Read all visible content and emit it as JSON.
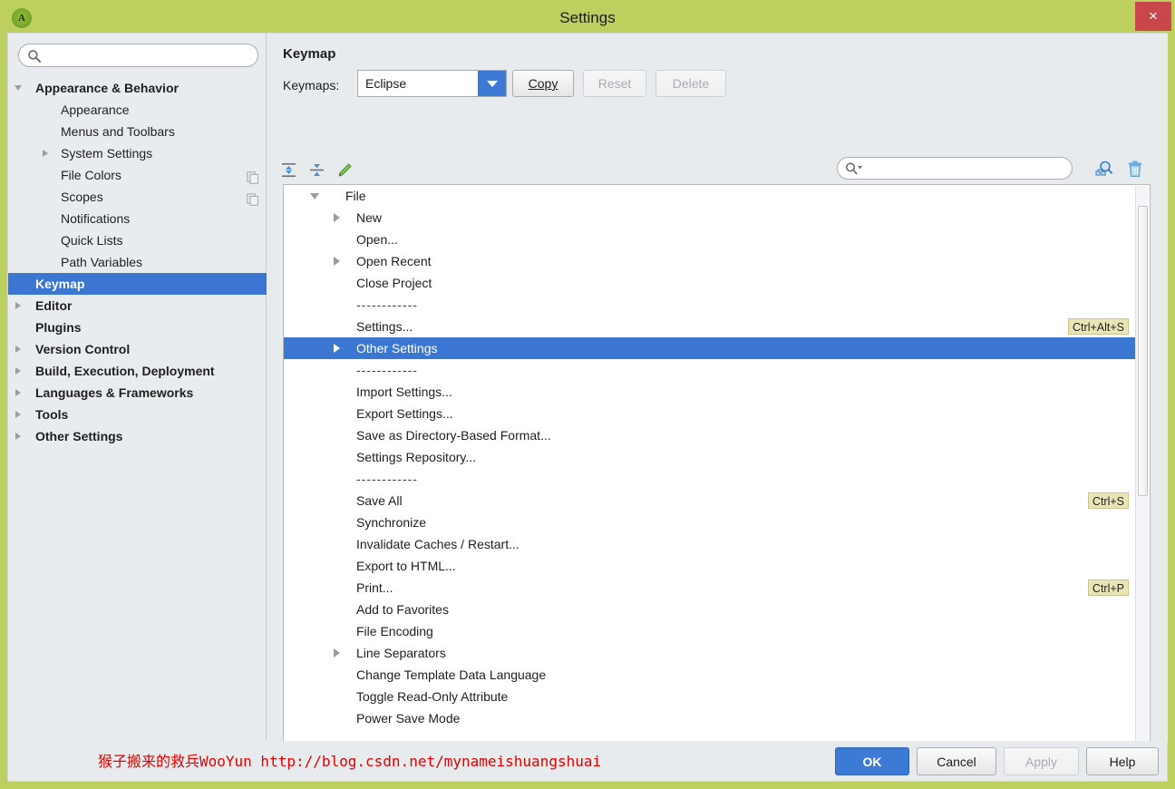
{
  "window": {
    "title": "Settings",
    "app_icon": "android-studio-icon",
    "close_label": "×",
    "titlebar_color": "#bccf5f",
    "accent_color": "#3a76d2"
  },
  "sidebar": {
    "search": {
      "placeholder": "",
      "value": "",
      "icon": "search-icon"
    },
    "items": [
      {
        "label": "Appearance & Behavior",
        "level": 0,
        "arrow": "down",
        "selected": false,
        "copy_icon": false
      },
      {
        "label": "Appearance",
        "level": 1,
        "arrow": "none",
        "selected": false,
        "copy_icon": false
      },
      {
        "label": "Menus and Toolbars",
        "level": 1,
        "arrow": "none",
        "selected": false,
        "copy_icon": false
      },
      {
        "label": "System Settings",
        "level": 1,
        "arrow": "right",
        "selected": false,
        "copy_icon": false
      },
      {
        "label": "File Colors",
        "level": 1,
        "arrow": "none",
        "selected": false,
        "copy_icon": true
      },
      {
        "label": "Scopes",
        "level": 1,
        "arrow": "none",
        "selected": false,
        "copy_icon": true
      },
      {
        "label": "Notifications",
        "level": 1,
        "arrow": "none",
        "selected": false,
        "copy_icon": false
      },
      {
        "label": "Quick Lists",
        "level": 1,
        "arrow": "none",
        "selected": false,
        "copy_icon": false
      },
      {
        "label": "Path Variables",
        "level": 1,
        "arrow": "none",
        "selected": false,
        "copy_icon": false
      },
      {
        "label": "Keymap",
        "level": 0,
        "arrow": "none",
        "selected": true,
        "copy_icon": false
      },
      {
        "label": "Editor",
        "level": 0,
        "arrow": "right",
        "selected": false,
        "copy_icon": false
      },
      {
        "label": "Plugins",
        "level": 0,
        "arrow": "none",
        "selected": false,
        "copy_icon": false
      },
      {
        "label": "Version Control",
        "level": 0,
        "arrow": "right",
        "selected": false,
        "copy_icon": false
      },
      {
        "label": "Build, Execution, Deployment",
        "level": 0,
        "arrow": "right",
        "selected": false,
        "copy_icon": false
      },
      {
        "label": "Languages & Frameworks",
        "level": 0,
        "arrow": "right",
        "selected": false,
        "copy_icon": false
      },
      {
        "label": "Tools",
        "level": 0,
        "arrow": "right",
        "selected": false,
        "copy_icon": false
      },
      {
        "label": "Other Settings",
        "level": 0,
        "arrow": "right",
        "selected": false,
        "copy_icon": false
      }
    ]
  },
  "main": {
    "panel_title": "Keymap",
    "keymaps_label": "Keymaps:",
    "keymap_selected": "Eclipse",
    "buttons": {
      "copy": "Copy",
      "reset": "Reset",
      "delete": "Delete"
    },
    "toolbar_icons": [
      {
        "name": "expand-all-icon",
        "title": "Expand All"
      },
      {
        "name": "collapse-all-icon",
        "title": "Collapse All"
      },
      {
        "name": "edit-shortcut-icon",
        "title": "Edit Shortcut"
      }
    ],
    "filter_search": {
      "placeholder": "",
      "value": "",
      "icon": "search-dropdown-icon"
    },
    "right_icons": [
      {
        "name": "find-by-shortcut-icon"
      },
      {
        "name": "clear-filter-trash-icon"
      }
    ],
    "tree": [
      {
        "label": "File",
        "depth": 0,
        "arrow": "down",
        "selected": false,
        "shortcut": "",
        "separator": false
      },
      {
        "label": "New",
        "depth": 1,
        "arrow": "right",
        "selected": false,
        "shortcut": "",
        "separator": false
      },
      {
        "label": "Open...",
        "depth": 1,
        "arrow": "none",
        "selected": false,
        "shortcut": "",
        "separator": false
      },
      {
        "label": "Open Recent",
        "depth": 1,
        "arrow": "right",
        "selected": false,
        "shortcut": "",
        "separator": false
      },
      {
        "label": "Close Project",
        "depth": 1,
        "arrow": "none",
        "selected": false,
        "shortcut": "",
        "separator": false
      },
      {
        "label": "------------",
        "depth": 1,
        "arrow": "none",
        "selected": false,
        "shortcut": "",
        "separator": true
      },
      {
        "label": "Settings...",
        "depth": 1,
        "arrow": "none",
        "selected": false,
        "shortcut": "Ctrl+Alt+S",
        "separator": false
      },
      {
        "label": "Other Settings",
        "depth": 1,
        "arrow": "right",
        "selected": true,
        "shortcut": "",
        "separator": false
      },
      {
        "label": "------------",
        "depth": 1,
        "arrow": "none",
        "selected": false,
        "shortcut": "",
        "separator": true
      },
      {
        "label": "Import Settings...",
        "depth": 1,
        "arrow": "none",
        "selected": false,
        "shortcut": "",
        "separator": false
      },
      {
        "label": "Export Settings...",
        "depth": 1,
        "arrow": "none",
        "selected": false,
        "shortcut": "",
        "separator": false
      },
      {
        "label": "Save as Directory-Based Format...",
        "depth": 1,
        "arrow": "none",
        "selected": false,
        "shortcut": "",
        "separator": false
      },
      {
        "label": "Settings Repository...",
        "depth": 1,
        "arrow": "none",
        "selected": false,
        "shortcut": "",
        "separator": false
      },
      {
        "label": "------------",
        "depth": 1,
        "arrow": "none",
        "selected": false,
        "shortcut": "",
        "separator": true
      },
      {
        "label": "Save All",
        "depth": 1,
        "arrow": "none",
        "selected": false,
        "shortcut": "Ctrl+S",
        "separator": false
      },
      {
        "label": "Synchronize",
        "depth": 1,
        "arrow": "none",
        "selected": false,
        "shortcut": "",
        "separator": false
      },
      {
        "label": "Invalidate Caches / Restart...",
        "depth": 1,
        "arrow": "none",
        "selected": false,
        "shortcut": "",
        "separator": false
      },
      {
        "label": "Export to HTML...",
        "depth": 1,
        "arrow": "none",
        "selected": false,
        "shortcut": "",
        "separator": false
      },
      {
        "label": "Print...",
        "depth": 1,
        "arrow": "none",
        "selected": false,
        "shortcut": "Ctrl+P",
        "separator": false
      },
      {
        "label": "Add to Favorites",
        "depth": 1,
        "arrow": "none",
        "selected": false,
        "shortcut": "",
        "separator": false
      },
      {
        "label": "File Encoding",
        "depth": 1,
        "arrow": "none",
        "selected": false,
        "shortcut": "",
        "separator": false
      },
      {
        "label": "Line Separators",
        "depth": 1,
        "arrow": "right",
        "selected": false,
        "shortcut": "",
        "separator": false
      },
      {
        "label": "Change Template Data Language",
        "depth": 1,
        "arrow": "none",
        "selected": false,
        "shortcut": "",
        "separator": false
      },
      {
        "label": "Toggle Read-Only Attribute",
        "depth": 1,
        "arrow": "none",
        "selected": false,
        "shortcut": "",
        "separator": false
      },
      {
        "label": "Power Save Mode",
        "depth": 1,
        "arrow": "none",
        "selected": false,
        "shortcut": "",
        "separator": false
      }
    ]
  },
  "bottom": {
    "watermark": "猴子搬来的救兵WooYun http://blog.csdn.net/mynameishuangshuai",
    "watermark_color": "#e60000",
    "ok": "OK",
    "cancel": "Cancel",
    "apply": "Apply",
    "help": "Help"
  }
}
